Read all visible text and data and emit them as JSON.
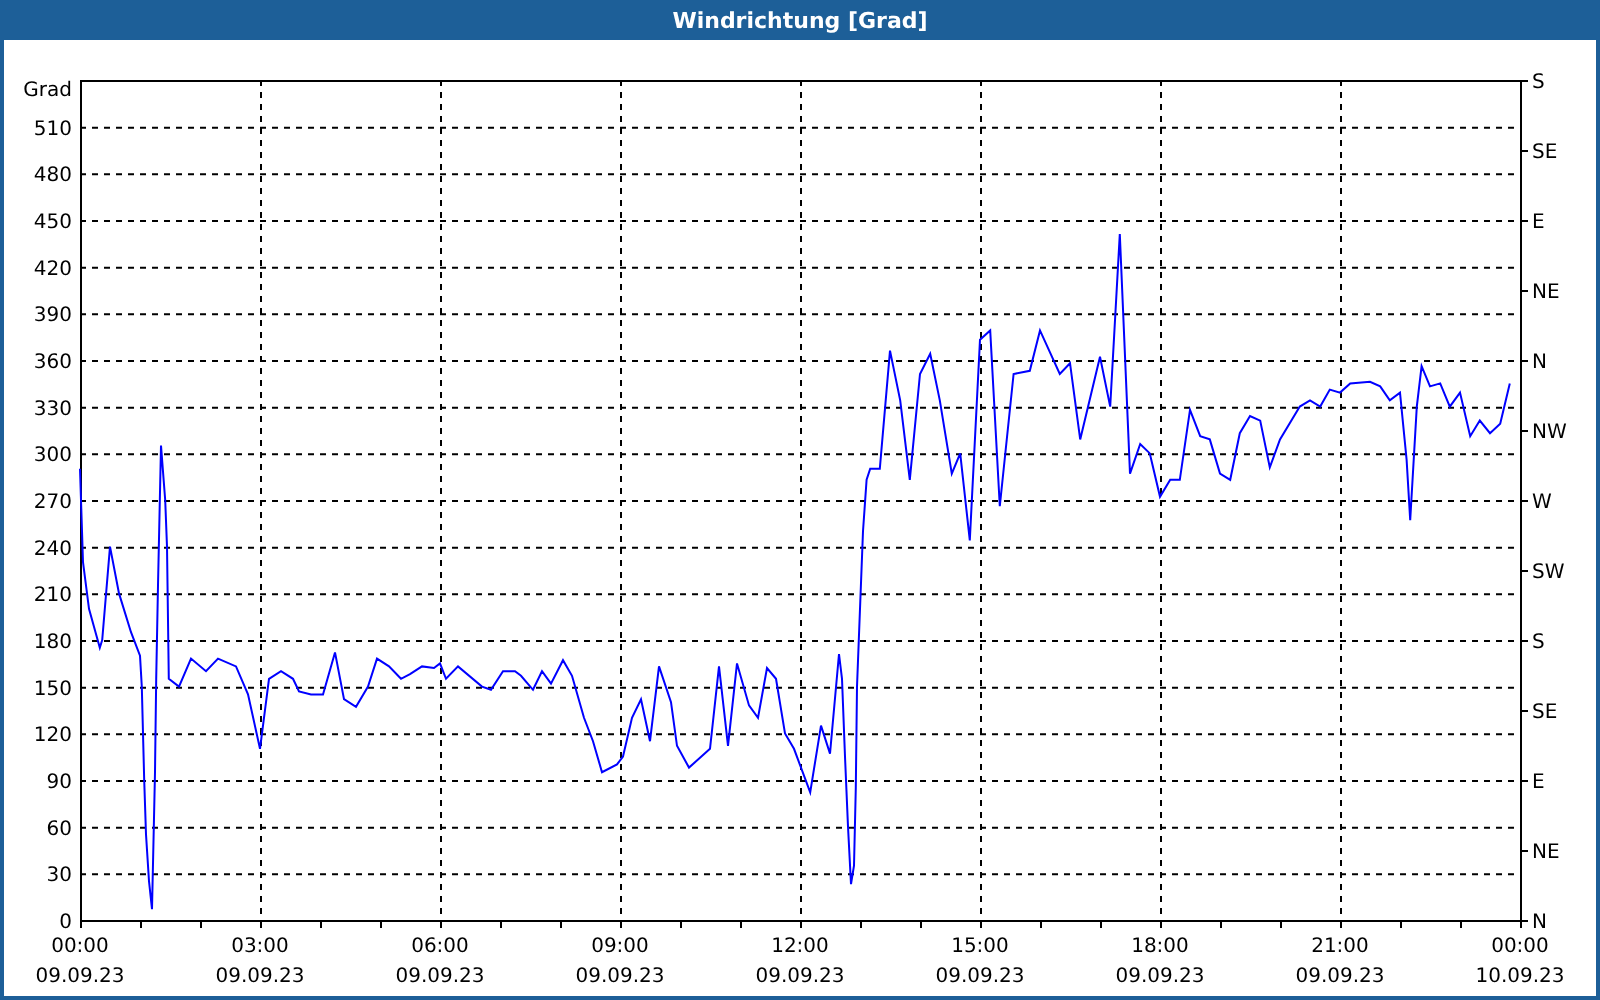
{
  "window": {
    "title": "Windrichtung [Grad]"
  },
  "chart": {
    "chart_data": {
      "type": "line",
      "ylabel": "Grad",
      "xlim": [
        0,
        24
      ],
      "ylim": [
        0,
        540
      ],
      "yticks": [
        0,
        30,
        60,
        90,
        120,
        150,
        180,
        210,
        240,
        270,
        300,
        330,
        360,
        390,
        420,
        450,
        480,
        510
      ],
      "xticks": [
        {
          "value": 0,
          "label": "00:00"
        },
        {
          "value": 3,
          "label": "03:00"
        },
        {
          "value": 6,
          "label": "06:00"
        },
        {
          "value": 9,
          "label": "09:00"
        },
        {
          "value": 12,
          "label": "12:00"
        },
        {
          "value": 15,
          "label": "15:00"
        },
        {
          "value": 18,
          "label": "18:00"
        },
        {
          "value": 21,
          "label": "21:00"
        },
        {
          "value": 24,
          "label": "00:00"
        }
      ],
      "grid": true,
      "x": [
        0,
        0.05,
        0.15,
        0.33,
        0.37,
        0.5,
        0.65,
        0.85,
        1.0,
        1.03,
        1.07,
        1.1,
        1.15,
        1.2,
        1.25,
        1.27,
        1.3,
        1.35,
        1.42,
        1.45,
        1.48,
        1.65,
        1.85,
        2.1,
        2.3,
        2.6,
        2.8,
        3.0,
        3.15,
        3.35,
        3.55,
        3.65,
        3.85,
        4.05,
        4.25,
        4.4,
        4.6,
        4.8,
        4.95,
        5.15,
        5.35,
        5.5,
        5.7,
        5.9,
        6.0,
        6.1,
        6.3,
        6.7,
        6.85,
        7.05,
        7.25,
        7.35,
        7.55,
        7.7,
        7.85,
        8.05,
        8.2,
        8.4,
        8.55,
        8.7,
        8.95,
        9.05,
        9.2,
        9.35,
        9.5,
        9.65,
        9.85,
        9.95,
        10.15,
        10.5,
        10.65,
        10.8,
        10.95,
        11.15,
        11.3,
        11.45,
        11.6,
        11.75,
        11.9,
        12.17,
        12.35,
        12.5,
        12.65,
        12.7,
        12.75,
        12.8,
        12.85,
        12.9,
        12.93,
        12.95,
        13.0,
        13.05,
        13.11,
        13.17,
        13.33,
        13.5,
        13.67,
        13.83,
        14.0,
        14.17,
        14.33,
        14.53,
        14.67,
        14.83,
        15.0,
        15.17,
        15.33,
        15.56,
        15.83,
        16.0,
        16.33,
        16.5,
        16.67,
        17.0,
        17.17,
        17.33,
        17.5,
        17.67,
        17.83,
        18.0,
        18.17,
        18.33,
        18.5,
        18.67,
        18.83,
        19.0,
        19.17,
        19.33,
        19.5,
        19.67,
        19.83,
        20.0,
        20.33,
        20.5,
        20.67,
        20.83,
        21.0,
        21.17,
        21.5,
        21.67,
        21.83,
        22.0,
        22.11,
        22.17,
        22.28,
        22.36,
        22.5,
        22.67,
        22.83,
        23.0,
        23.17,
        23.33,
        23.5,
        23.67,
        23.83
      ],
      "series": [
        {
          "color": "#0000ff",
          "values": [
            290,
            230,
            200,
            175,
            180,
            240,
            210,
            185,
            170,
            150,
            90,
            55,
            25,
            7,
            95,
            155,
            215,
            305,
            270,
            240,
            155,
            150,
            168,
            160,
            168,
            163,
            145,
            110,
            155,
            160,
            155,
            147,
            145,
            145,
            172,
            142,
            137,
            150,
            168,
            163,
            155,
            158,
            163,
            162,
            165,
            155,
            163,
            150,
            148,
            160,
            160,
            157,
            148,
            160,
            152,
            167,
            157,
            130,
            115,
            95,
            100,
            105,
            130,
            142,
            115,
            163,
            140,
            112,
            98,
            110,
            163,
            112,
            165,
            138,
            130,
            162,
            155,
            120,
            110,
            82,
            125,
            107,
            171,
            155,
            105,
            60,
            23,
            35,
            85,
            150,
            200,
            250,
            283,
            290,
            290,
            366,
            334,
            283,
            351,
            364,
            334,
            287,
            300,
            244,
            373,
            379,
            266,
            351,
            353,
            379,
            351,
            358,
            309,
            362,
            330,
            441,
            287,
            306,
            300,
            272,
            283,
            283,
            328,
            311,
            309,
            287,
            283,
            313,
            324,
            321,
            291,
            309,
            330,
            334,
            330,
            341,
            339,
            345,
            346,
            343,
            334,
            339,
            296,
            257,
            330,
            356,
            343,
            345,
            330,
            339,
            311,
            321,
            313,
            319,
            345
          ]
        }
      ]
    },
    "x_dates": [
      "09.09.23",
      "09.09.23",
      "09.09.23",
      "09.09.23",
      "09.09.23",
      "09.09.23",
      "09.09.23",
      "09.09.23",
      "10.09.23"
    ],
    "direction_labels": [
      "S",
      "SE",
      "E",
      "NE",
      "N",
      "NW",
      "W",
      "SW",
      "S",
      "SE",
      "E",
      "NE",
      "N"
    ]
  }
}
